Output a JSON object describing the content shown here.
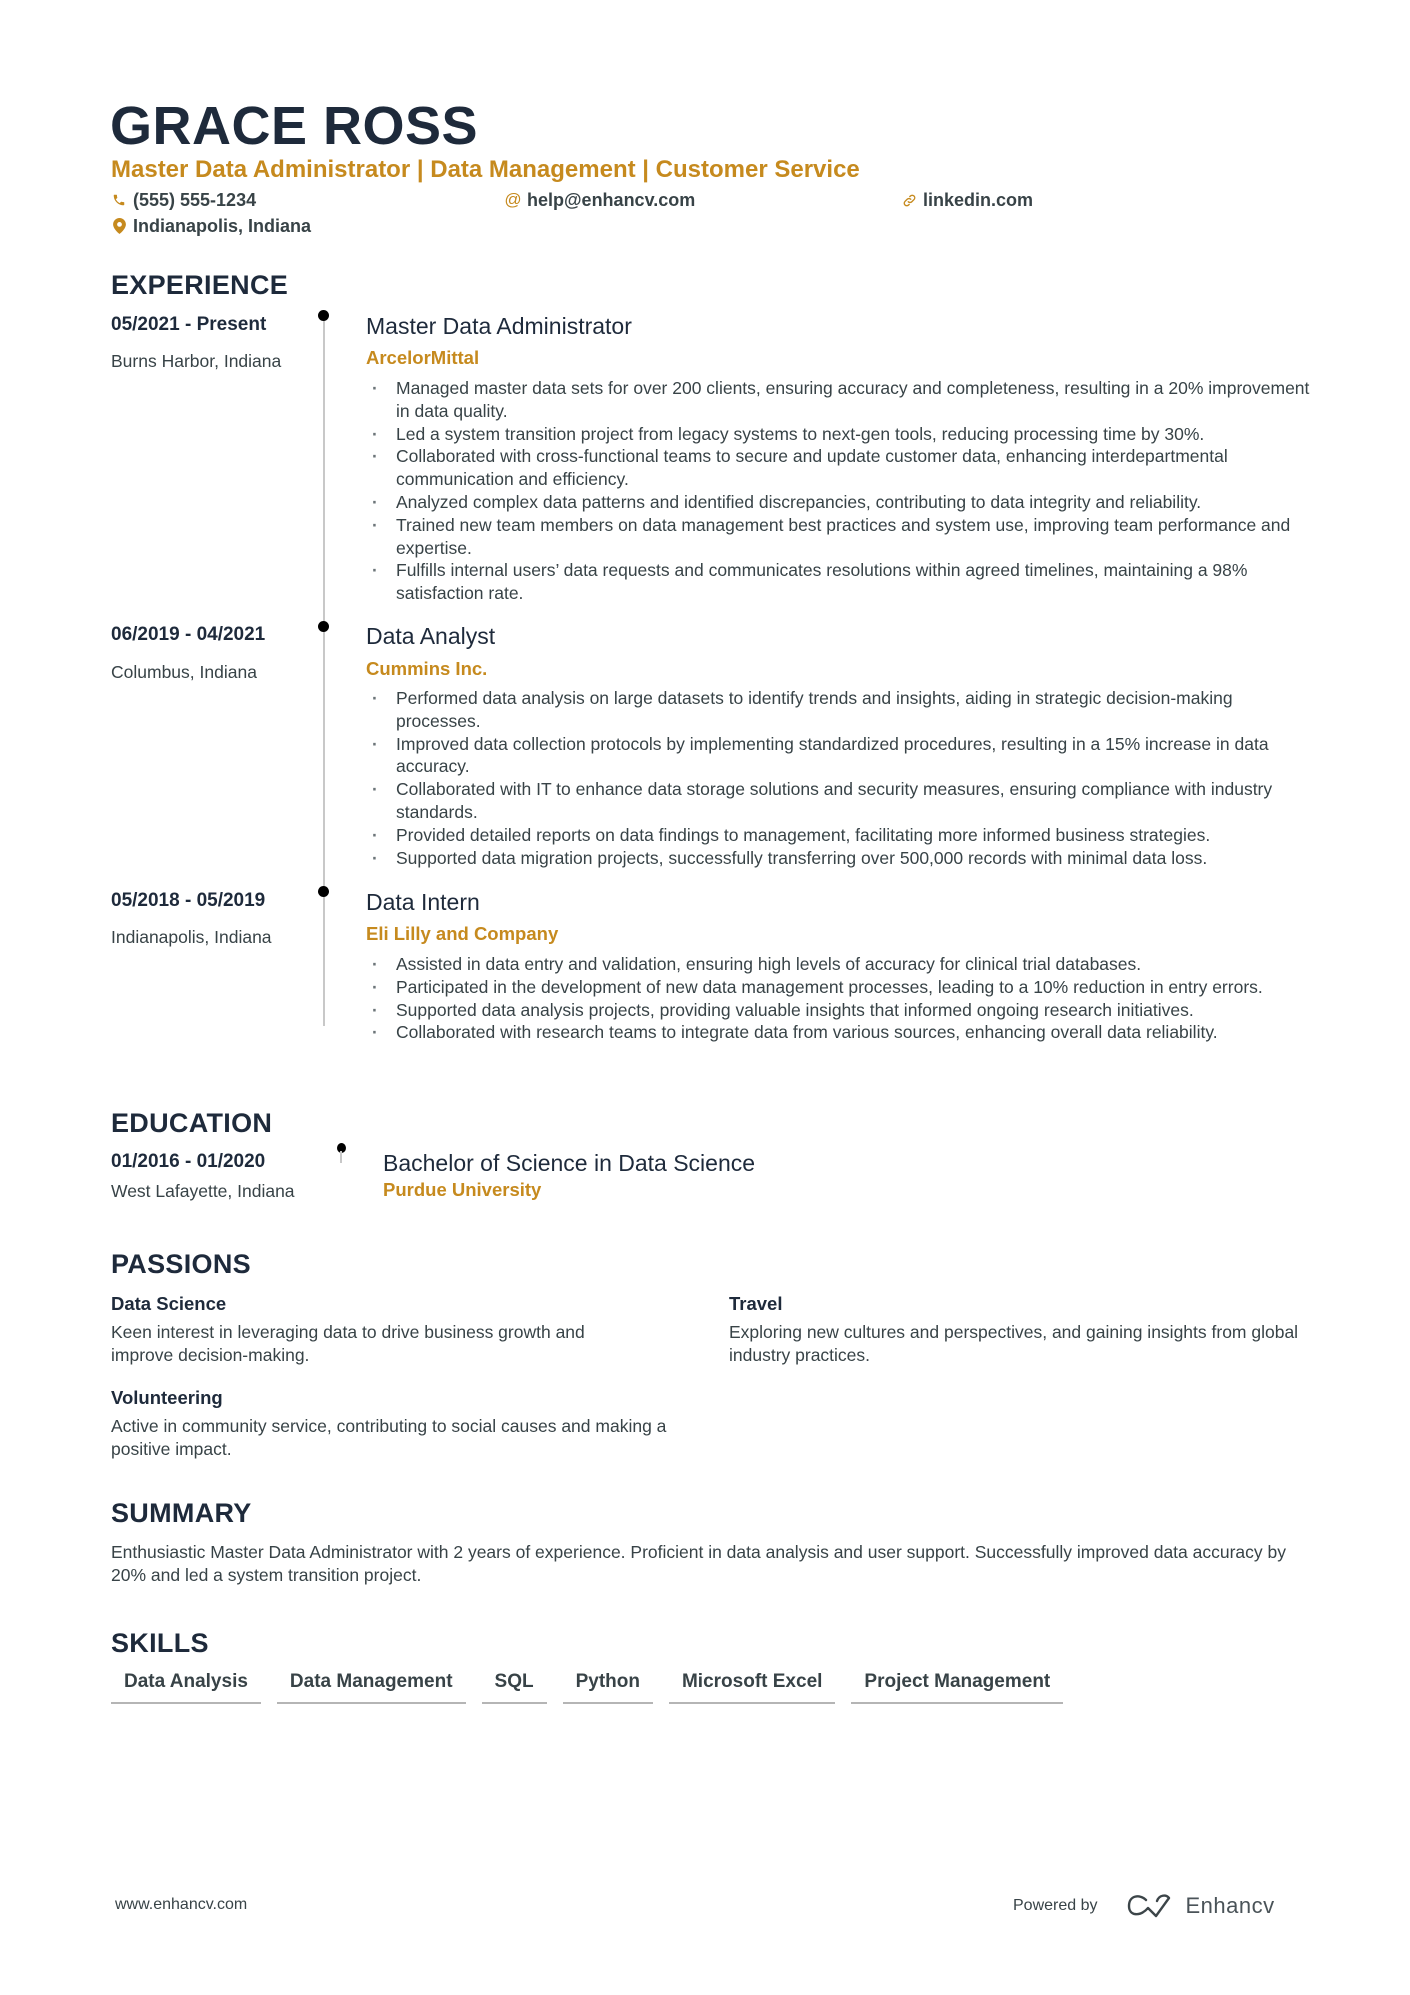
{
  "header": {
    "name": "GRACE ROSS",
    "headline": "Master Data Administrator | Data Management | Customer Service",
    "contacts": {
      "phone": {
        "icon": "phone-icon",
        "value": "(555) 555-1234"
      },
      "email": {
        "icon": "at-icon",
        "value": "help@enhancv.com"
      },
      "linkedin": {
        "icon": "link-icon",
        "value": "linkedin.com"
      },
      "location": {
        "icon": "location-pin-icon",
        "value": "Indianapolis, Indiana"
      }
    }
  },
  "experience": {
    "title": "EXPERIENCE",
    "items": [
      {
        "dates": "05/2021 - Present",
        "location": "Burns Harbor, Indiana",
        "role": "Master Data Administrator",
        "company": "ArcelorMittal",
        "bullets": [
          "Managed master data sets for over 200 clients, ensuring accuracy and completeness, resulting in a 20% improvement in data quality.",
          "Led a system transition project from legacy systems to next-gen tools, reducing processing time by 30%.",
          "Collaborated with cross-functional teams to secure and update customer data, enhancing interdepartmental communication and efficiency.",
          "Analyzed complex data patterns and identified discrepancies, contributing to data integrity and reliability.",
          "Trained new team members on data management best practices and system use, improving team performance and expertise.",
          "Fulfills internal users’ data requests and communicates resolutions within agreed timelines, maintaining a 98% satisfaction rate."
        ]
      },
      {
        "dates": "06/2019 - 04/2021",
        "location": "Columbus, Indiana",
        "role": "Data Analyst",
        "company": "Cummins Inc.",
        "bullets": [
          "Performed data analysis on large datasets to identify trends and insights, aiding in strategic decision-making processes.",
          "Improved data collection protocols by implementing standardized procedures, resulting in a 15% increase in data accuracy.",
          "Collaborated with IT to enhance data storage solutions and security measures, ensuring compliance with industry standards.",
          "Provided detailed reports on data findings to management, facilitating more informed business strategies.",
          "Supported data migration projects, successfully transferring over 500,000 records with minimal data loss."
        ]
      },
      {
        "dates": "05/2018 - 05/2019",
        "location": "Indianapolis, Indiana",
        "role": "Data Intern",
        "company": "Eli Lilly and Company",
        "bullets": [
          "Assisted in data entry and validation, ensuring high levels of accuracy for clinical trial databases.",
          "Participated in the development of new data management processes, leading to a 10% reduction in entry errors.",
          "Supported data analysis projects, providing valuable insights that informed ongoing research initiatives.",
          "Collaborated with research teams to integrate data from various sources, enhancing overall data reliability."
        ]
      }
    ]
  },
  "education": {
    "title": "EDUCATION",
    "items": [
      {
        "dates": "01/2016 - 01/2020",
        "location": "West Lafayette, Indiana",
        "degree": "Bachelor of Science in Data Science",
        "school": "Purdue University"
      }
    ]
  },
  "passions": {
    "title": "PASSIONS",
    "items": [
      {
        "title": "Data Science",
        "description": "Keen interest in leveraging data to drive business growth and improve decision-making."
      },
      {
        "title": "Travel",
        "description": "Exploring new cultures and perspectives, and gaining insights from global industry practices."
      },
      {
        "title": "Volunteering",
        "description": "Active in community service, contributing to social causes and making a positive impact."
      }
    ]
  },
  "summary": {
    "title": "SUMMARY",
    "text": "Enthusiastic Master Data Administrator with 2 years of experience. Proficient in data analysis and user support. Successfully improved data accuracy by 20% and led a system transition project."
  },
  "skills": {
    "title": "SKILLS",
    "items": [
      "Data Analysis",
      "Data Management",
      "SQL",
      "Python",
      "Microsoft Excel",
      "Project Management"
    ]
  },
  "footer": {
    "url": "www.enhancv.com",
    "powered_by": "Powered by",
    "brand": "Enhancv"
  },
  "colors": {
    "accent": "#c68a1e",
    "heading": "#1e2a3b",
    "body": "#384347"
  }
}
